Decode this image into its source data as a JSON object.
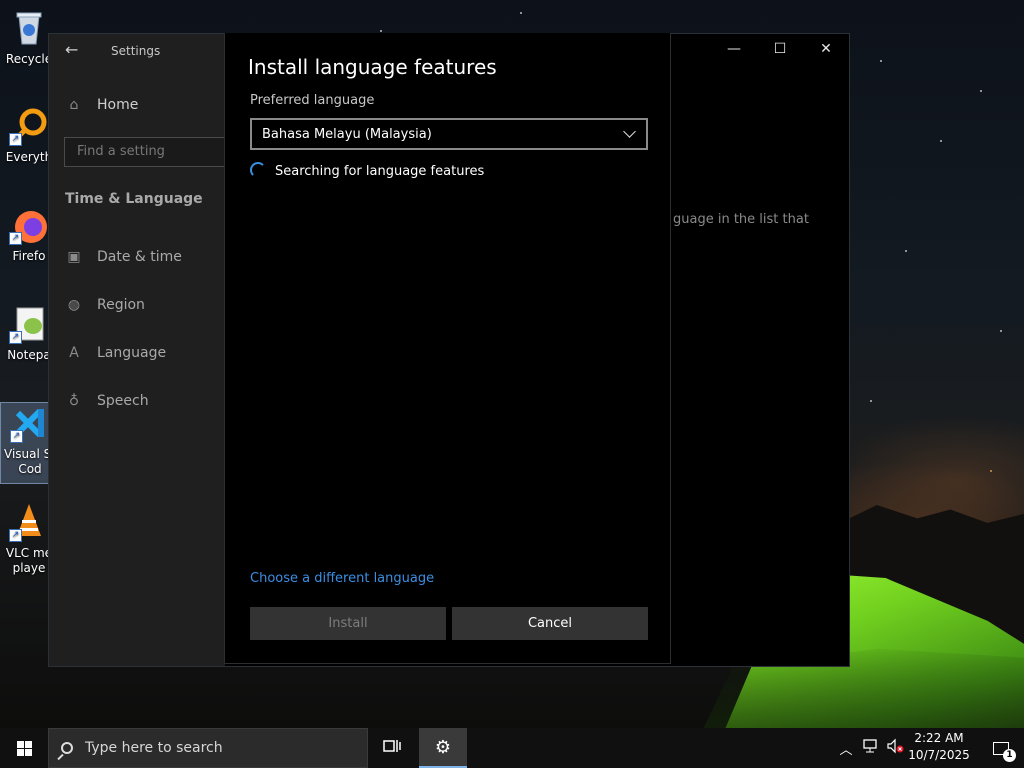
{
  "desktop": {
    "icons": [
      {
        "label": "Recycle",
        "icon": "recycle-bin-icon"
      },
      {
        "label": "Everyth",
        "icon": "everything-search-icon"
      },
      {
        "label": "Firefo",
        "icon": "firefox-icon"
      },
      {
        "label": "Notepa",
        "icon": "notepad-plus-plus-icon"
      },
      {
        "label": "Visual St",
        "label2": "Cod",
        "icon": "vscode-icon"
      },
      {
        "label": "VLC me",
        "label2": "playe",
        "icon": "vlc-icon"
      }
    ]
  },
  "settings": {
    "window_title": "Settings",
    "home_label": "Home",
    "find_placeholder": "Find a setting",
    "section_title": "Time & Language",
    "nav": [
      {
        "label": "Date & time",
        "icon": "calendar-clock-icon"
      },
      {
        "label": "Region",
        "icon": "globe-icon"
      },
      {
        "label": "Language",
        "icon": "language-icon"
      },
      {
        "label": "Speech",
        "icon": "microphone-icon"
      }
    ],
    "background_text": "guage in the list that",
    "caption": {
      "minimize": "—",
      "maximize": "☐",
      "close": "✕"
    }
  },
  "dialog": {
    "title": "Install language features",
    "preferred_language_label": "Preferred language",
    "selected_language": "Bahasa Melayu (Malaysia)",
    "status_text": "Searching for language features",
    "link_text": "Choose a different language",
    "install_label": "Install",
    "cancel_label": "Cancel"
  },
  "taskbar": {
    "search_placeholder": "Type here to search",
    "time": "2:22 AM",
    "date": "10/7/2025",
    "notification_count": "1"
  },
  "colors": {
    "accent_link": "#3d8ee3",
    "button_bg": "#333333",
    "dialog_bg": "#000000",
    "tent_green": "#7ed321"
  }
}
